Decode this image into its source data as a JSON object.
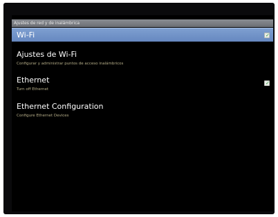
{
  "title_bar": {
    "text": "Ajustes de red y de inalámbrica"
  },
  "items": [
    {
      "label": "Wi-Fi",
      "summary": "",
      "checked": true
    },
    {
      "label": "Ajustes de Wi-Fi",
      "summary": "Configurar y administrar puntos de acceso inalámbricos"
    },
    {
      "label": "Ethernet",
      "summary": "Turn off Ethernet",
      "checked": true
    },
    {
      "label": "Ethernet Configuration",
      "summary": "Configure Ethernet Devices"
    }
  ],
  "colors": {
    "selected_row": "#6f8fc6",
    "summary_text": "#b8b08a",
    "check_green": "#2f9e3a"
  },
  "icons": {
    "checkbox": "checkbox-checked-icon"
  }
}
